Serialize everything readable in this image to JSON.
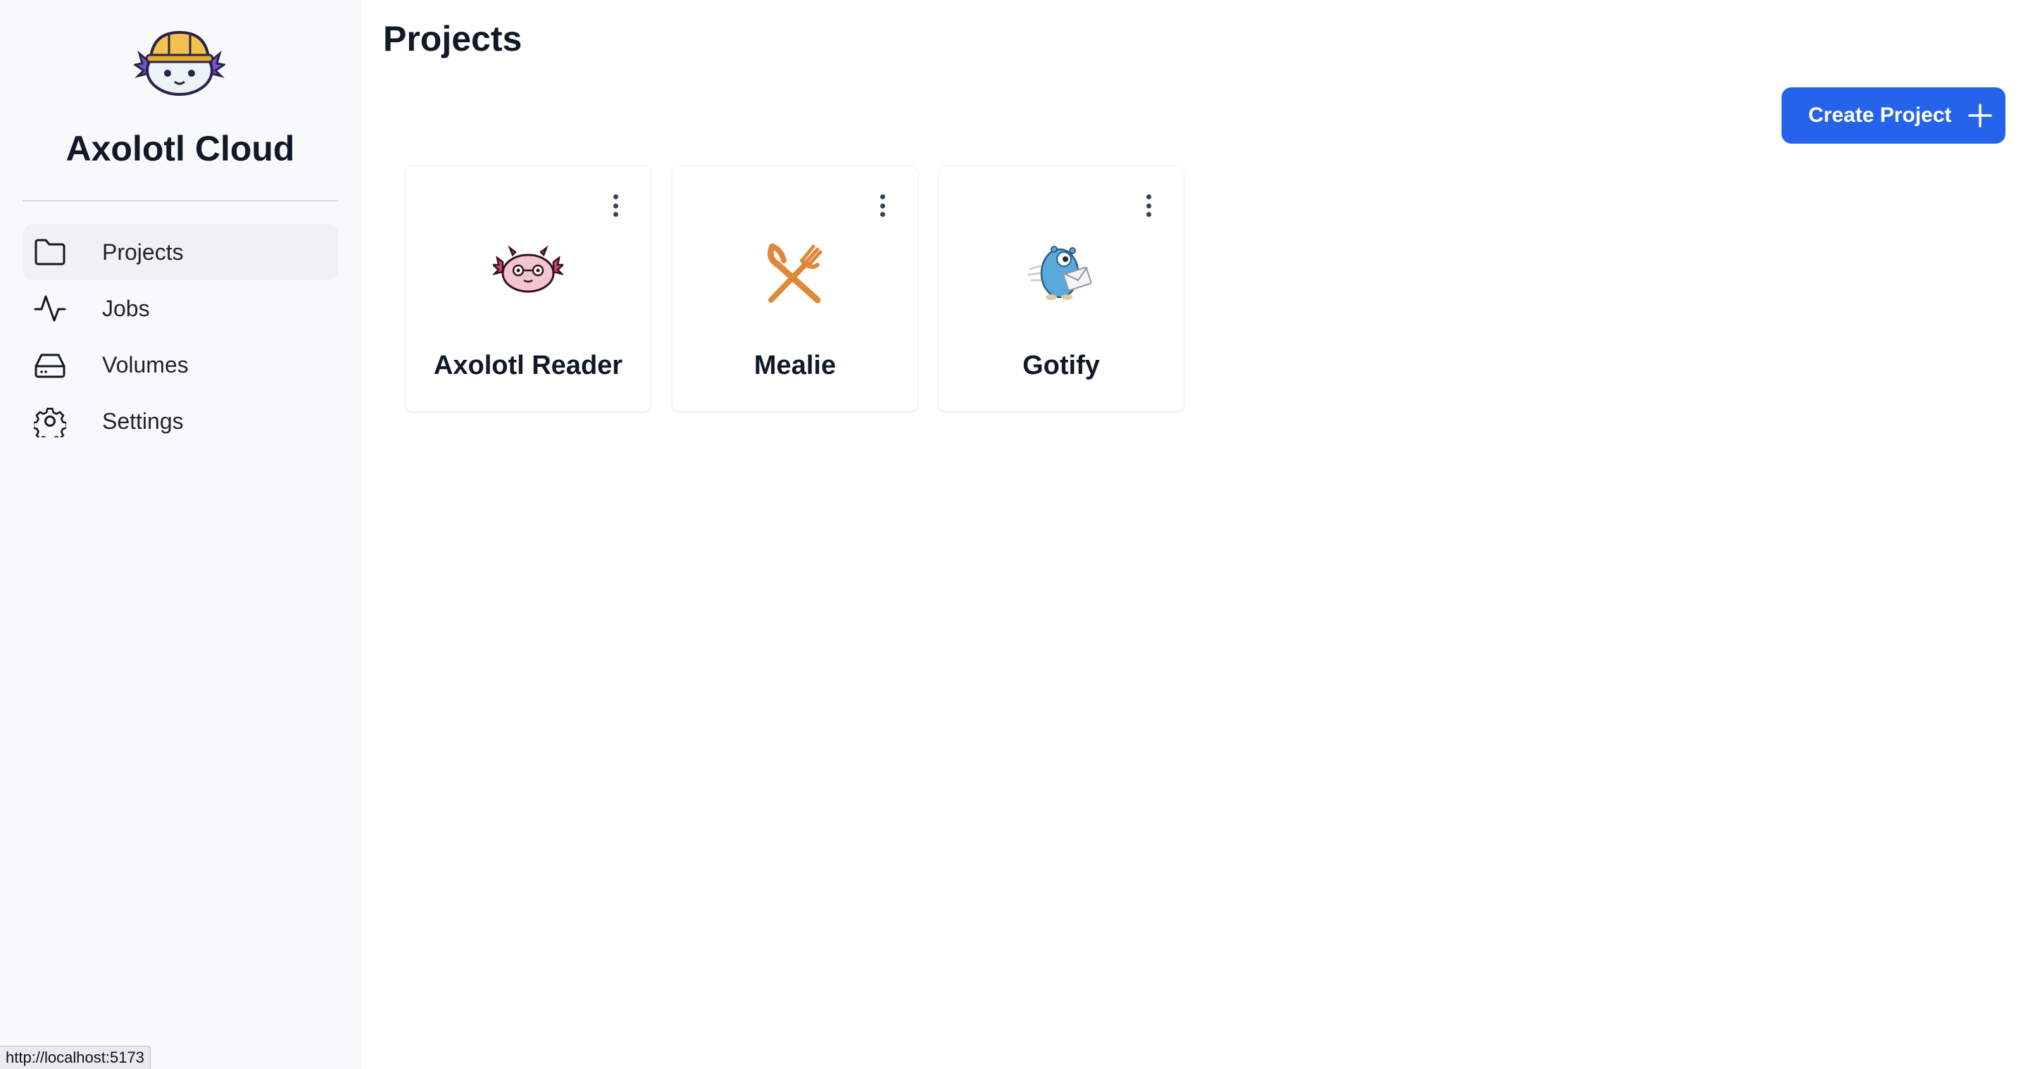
{
  "sidebar": {
    "brand": "Axolotl Cloud",
    "items": [
      {
        "label": "Projects",
        "icon": "folder-icon",
        "active": true
      },
      {
        "label": "Jobs",
        "icon": "activity-icon",
        "active": false
      },
      {
        "label": "Volumes",
        "icon": "hard-drive-icon",
        "active": false
      },
      {
        "label": "Settings",
        "icon": "gear-icon",
        "active": false
      }
    ]
  },
  "main": {
    "title": "Projects",
    "create_button_label": "Create Project",
    "projects": [
      {
        "name": "Axolotl Reader",
        "icon": "axolotl-icon"
      },
      {
        "name": "Mealie",
        "icon": "fork-knife-icon"
      },
      {
        "name": "Gotify",
        "icon": "gopher-mail-icon"
      }
    ]
  },
  "status_bar": {
    "url": "http://localhost:5173"
  },
  "colors": {
    "accent": "#2563eb",
    "sidebar_bg": "#f8f9fb",
    "mealie_orange": "#e0883a",
    "gotify_blue": "#5aa9dc"
  }
}
